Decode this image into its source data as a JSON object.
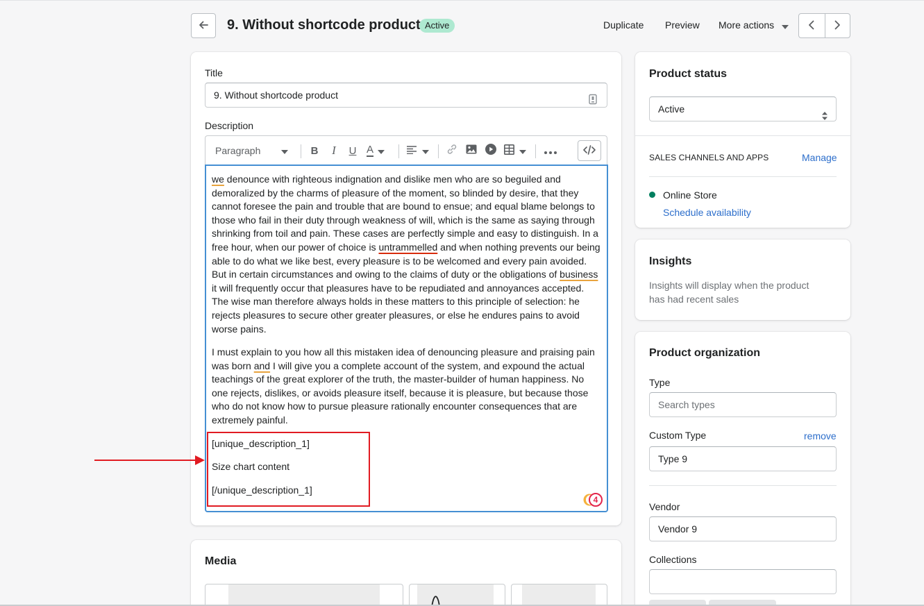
{
  "header": {
    "title": "9. Without shortcode product",
    "status_badge": "Active",
    "actions": [
      "Duplicate",
      "Preview",
      "More actions"
    ]
  },
  "main": {
    "title_label": "Title",
    "title_value": "9. Without shortcode product",
    "description_label": "Description",
    "toolbar": {
      "format_select": "Paragraph",
      "bold": "B",
      "italic": "I",
      "underline": "U",
      "text_color": "A"
    },
    "description": {
      "para1_segments": {
        "s1": "we",
        "s2": " denounce with righteous indignation and dislike men who are so beguiled and demoralized by the charms of pleasure of the moment, so blinded by desire, that they cannot foresee the pain and trouble that are bound to ensue; and equal blame belongs to those who fail in their duty through weakness of will, which is the same as saying through shrinking from toil and pain. These cases are perfectly simple and easy to distinguish. In a free hour, when our power of choice is ",
        "s3": "untrammelled",
        "s4": " and when nothing prevents our being able to do what we like best, every pleasure is to be welcomed and every pain avoided. But in certain circumstances and owing to the claims of duty or the obligations of ",
        "s5": "business",
        "s6": " it will frequently occur that pleasures have to be repudiated and annoyances accepted. The wise man therefore always holds in these matters to this principle of selection: he rejects pleasures to secure other greater pleasures, or else he endures pains to avoid worse pains."
      },
      "para2_segments": {
        "s1": "I must explain to you how all this mistaken idea of denouncing pleasure and praising pain was born ",
        "s2": "and",
        "s3": " I will give you a complete account of the system, and expound the actual teachings of the great explorer of the truth, the master-builder of human happiness. No one rejects, dislikes, or avoids pleasure itself, because it is pleasure, but because those who do not know how to pursue pleasure rationally encounter consequences that are extremely painful."
      },
      "shortcode_open": "[unique_description_1]",
      "shortcode_content": "Size chart content",
      "shortcode_close": "[/unique_description_1]"
    },
    "grammarly_count": "4",
    "media_title": "Media"
  },
  "sidebar": {
    "status_card": {
      "title": "Product status",
      "status_value": "Active",
      "channels_heading": "SALES CHANNELS AND APPS",
      "manage_link": "Manage",
      "channel_name": "Online Store",
      "schedule_link": "Schedule availability"
    },
    "insights_card": {
      "title": "Insights",
      "text": "Insights will display when the product has had recent sales"
    },
    "organization_card": {
      "title": "Product organization",
      "type_label": "Type",
      "type_placeholder": "Search types",
      "custom_type_label": "Custom Type",
      "remove_link": "remove",
      "custom_type_value": "Type 9",
      "vendor_label": "Vendor",
      "vendor_value": "Vendor 9",
      "collections_label": "Collections"
    }
  },
  "colors": {
    "accent_link": "#2c6ecb",
    "badge_bg": "#aee9d1",
    "online_dot": "#007f5f",
    "editor_focus": "#458fd3",
    "annotation_red": "#e11b22"
  }
}
